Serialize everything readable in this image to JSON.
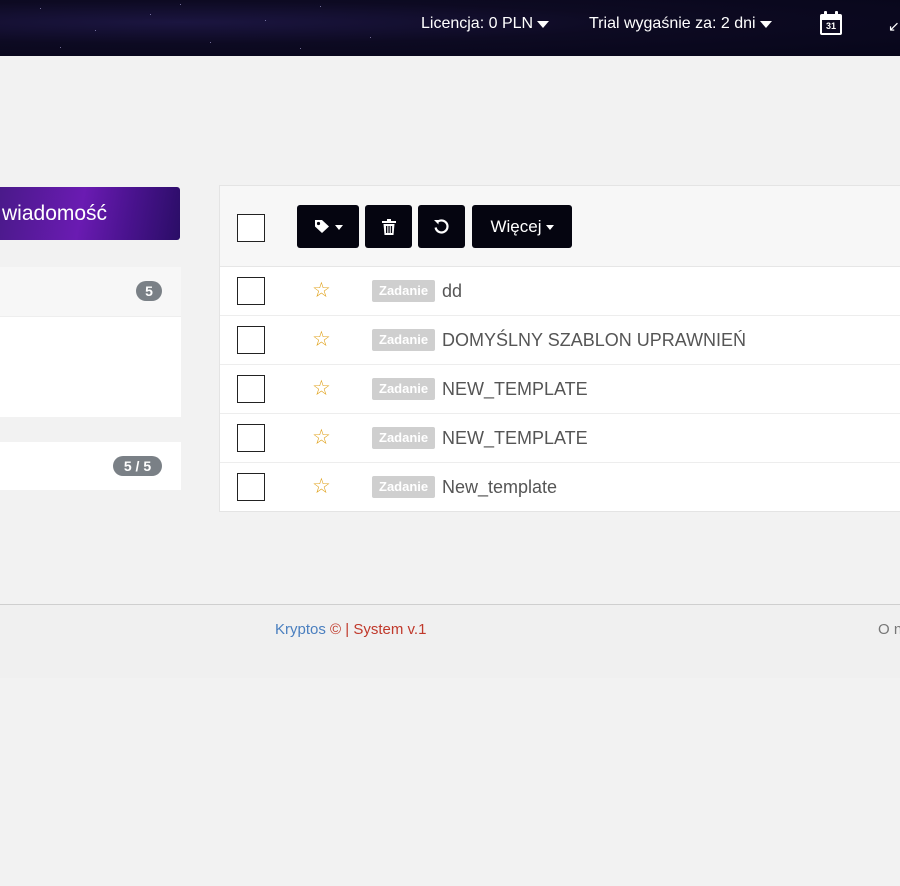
{
  "header": {
    "license_label": "Licencja: 0 PLN",
    "trial_label": "Trial wygaśnie za: 2 dni",
    "calendar_day": "31",
    "icons": [
      "calendar-icon",
      "resize-icon"
    ]
  },
  "sidebar": {
    "compose_label": "wiadomość",
    "folders_count": "5",
    "labels_count": "5 / 5"
  },
  "toolbar": {
    "more_label": "Więcej",
    "icons": [
      "tag-icon",
      "trash-icon",
      "refresh-icon"
    ]
  },
  "messages": [
    {
      "tag": "Zadanie",
      "subject": "dd"
    },
    {
      "tag": "Zadanie",
      "subject": "DOMYŚLNY SZABLON UPRAWNIEŃ"
    },
    {
      "tag": "Zadanie",
      "subject": "NEW_TEMPLATE"
    },
    {
      "tag": "Zadanie",
      "subject": "NEW_TEMPLATE"
    },
    {
      "tag": "Zadanie",
      "subject": "New_template"
    }
  ],
  "footer": {
    "brand": "Kryptos",
    "copyright": "©",
    "separator": "|",
    "system": "System v.1",
    "right_text": "O n"
  },
  "colors": {
    "compose_bg": "#6a1bb2",
    "toolbar_button_bg": "#050510",
    "star": "#e0a21b",
    "footer_brand": "#4a7fbf",
    "footer_system": "#c0392b"
  }
}
